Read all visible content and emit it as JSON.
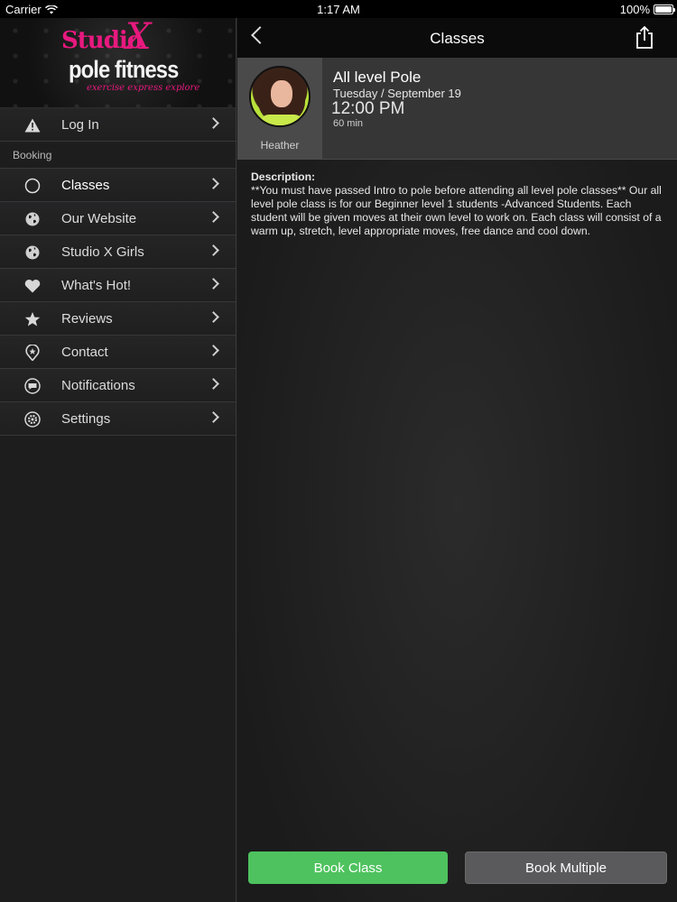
{
  "status_bar": {
    "carrier": "Carrier",
    "time": "1:17 AM",
    "battery": "100%"
  },
  "logo": {
    "studio": "Studio",
    "x": "X",
    "pole": "pole fitness",
    "tagline": "exercise express explore"
  },
  "menu": {
    "login": "Log In",
    "section_booking": "Booking",
    "items": [
      {
        "label": "Classes",
        "icon": "circle-icon"
      },
      {
        "label": "Our Website",
        "icon": "globe-icon"
      },
      {
        "label": "Studio X Girls",
        "icon": "globe-icon"
      },
      {
        "label": "What's Hot!",
        "icon": "heart-icon"
      },
      {
        "label": "Reviews",
        "icon": "star-icon"
      },
      {
        "label": "Contact",
        "icon": "location-pin-icon"
      },
      {
        "label": "Notifications",
        "icon": "chat-bubble-icon"
      },
      {
        "label": "Settings",
        "icon": "gear-icon"
      }
    ]
  },
  "navbar": {
    "title": "Classes"
  },
  "class": {
    "instructor": "Heather",
    "title": "All level Pole",
    "date": "Tuesday / September 19",
    "time": "12:00 PM",
    "duration": "60 min",
    "description_label": "Description:",
    "description": "**You must have passed Intro to pole before attending all level pole classes** Our all level pole class is for our Beginner level 1 students -Advanced Students. Each student will be given moves at their own level to work on.  Each class will consist of a warm up, stretch, level appropriate moves, free dance and cool down."
  },
  "buttons": {
    "book_class": "Book Class",
    "book_multiple": "Book Multiple"
  },
  "colors": {
    "accent_pink": "#e8197f",
    "book_green": "#4ec25e",
    "button_gray": "#5a5a5c"
  }
}
